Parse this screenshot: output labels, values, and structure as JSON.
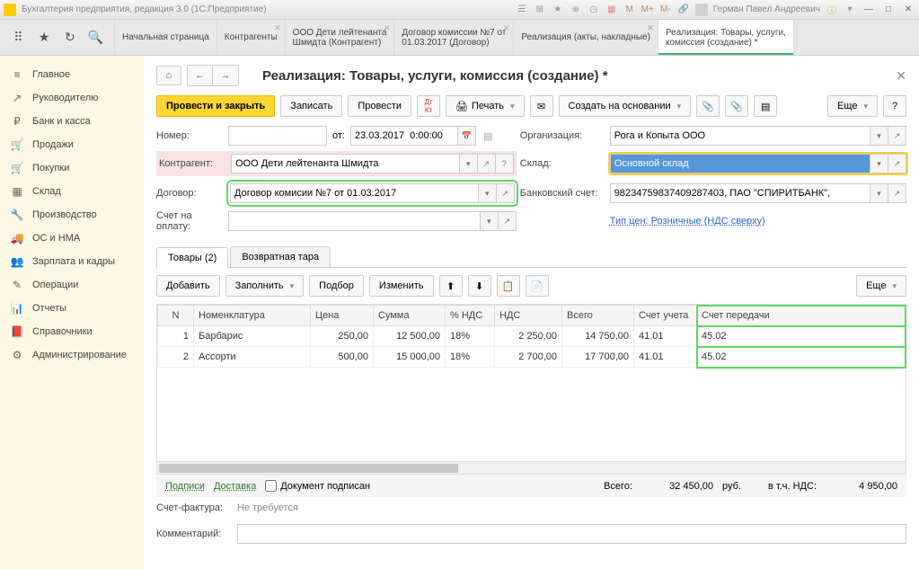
{
  "title_bar": {
    "app_title": "Бухгалтерия предприятия, редакция 3.0  (1С:Предприятие)",
    "user_name": "Герман Павел Андреевич"
  },
  "tabs": [
    {
      "label": "Начальная страница",
      "sub": ""
    },
    {
      "label": "Контрагенты",
      "sub": ""
    },
    {
      "label": "ООО Дети лейтенанта",
      "sub": "Шмидта (Контрагент)"
    },
    {
      "label": "Договор комиссии №7 от",
      "sub": "01.03.2017 (Договор)"
    },
    {
      "label": "Реализация (акты, накладные)",
      "sub": ""
    },
    {
      "label": "Реализация: Товары, услуги,",
      "sub": "комиссия (создание) *"
    }
  ],
  "sidebar": {
    "items": [
      {
        "label": "Главное",
        "icon": "≡"
      },
      {
        "label": "Руководителю",
        "icon": "↗"
      },
      {
        "label": "Банк и касса",
        "icon": "₽"
      },
      {
        "label": "Продажи",
        "icon": "🛒"
      },
      {
        "label": "Покупки",
        "icon": "🛒"
      },
      {
        "label": "Склад",
        "icon": "▦"
      },
      {
        "label": "Производство",
        "icon": "🔧"
      },
      {
        "label": "ОС и НМА",
        "icon": "🚚"
      },
      {
        "label": "Зарплата и кадры",
        "icon": "👥"
      },
      {
        "label": "Операции",
        "icon": "✎"
      },
      {
        "label": "Отчеты",
        "icon": "📊"
      },
      {
        "label": "Справочники",
        "icon": "📕"
      },
      {
        "label": "Администрирование",
        "icon": "⚙"
      }
    ]
  },
  "page": {
    "title": "Реализация: Товары, услуги, комиссия (создание) *",
    "toolbar": {
      "post_close": "Провести и закрыть",
      "write": "Записать",
      "post": "Провести",
      "print": "Печать",
      "create_based": "Создать на основании",
      "more": "Еще",
      "help": "?"
    },
    "form": {
      "number_label": "Номер:",
      "from_label": "от:",
      "date_value": "23.03.2017  0:00:00",
      "org_label": "Организация:",
      "org_value": "Рога и Копыта ООО",
      "counterparty_label": "Контрагент:",
      "counterparty_value": "ООО Дети лейтенанта Шмидта",
      "warehouse_label": "Склад:",
      "warehouse_value": "Основной склад",
      "contract_label": "Договор:",
      "contract_value": "Договор комисии №7 от 01.03.2017",
      "bank_label": "Банковский счет:",
      "bank_value": "98234759837409287403, ПАО \"СПИРИТБАНК\",",
      "payment_acc_label": "Счет на оплату:",
      "price_type_label": "Тип цен: Розничные (НДС сверху)"
    },
    "tabs2": {
      "goods": "Товары (2)",
      "tare": "Возвратная тара"
    },
    "table_tools": {
      "add": "Добавить",
      "fill": "Заполнить",
      "pick": "Подбор",
      "change": "Изменить",
      "more": "Еще"
    },
    "table": {
      "headers": [
        "N",
        "Номенклатура",
        "Цена",
        "Сумма",
        "% НДС",
        "НДС",
        "Всего",
        "Счет учета",
        "Счет передачи"
      ],
      "rows": [
        {
          "n": "1",
          "name": "Барбарис",
          "price": "250,00",
          "sum": "12 500,00",
          "vat_pct": "18%",
          "vat": "2 250,00",
          "total": "14 750,00",
          "acc": "41.01",
          "transfer": "45.02"
        },
        {
          "n": "2",
          "name": "Ассорти",
          "price": "500,00",
          "sum": "15 000,00",
          "vat_pct": "18%",
          "vat": "2 700,00",
          "total": "17 700,00",
          "acc": "41.01",
          "transfer": "45.02"
        }
      ]
    },
    "footer": {
      "signatures": "Подписи",
      "delivery": "Доставка",
      "doc_signed": "Документ подписан",
      "total_label": "Всего:",
      "total_value": "32 450,00",
      "currency": "руб.",
      "incl_vat_label": "в т.ч. НДС:",
      "incl_vat_value": "4 950,00",
      "invoice_label": "Счет-фактура:",
      "invoice_value": "Не требуется",
      "comment_label": "Комментарий:"
    }
  }
}
